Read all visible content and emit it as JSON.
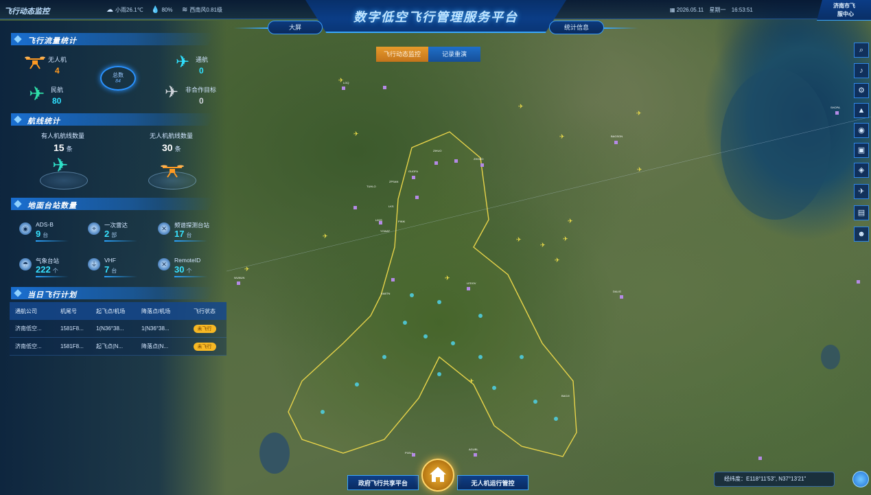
{
  "header": {
    "brand": "飞行动态监控",
    "weather": "小雨26.1℃",
    "humidity": "80%",
    "wind": "西南风0.81级",
    "date": "2026.05.11",
    "weekday": "星期一",
    "time": "16:53:51",
    "title": "数字低空飞行管理服务平台",
    "tab_left": "大屏",
    "tab_right": "统计信息",
    "city_line1": "济南市飞",
    "city_line2": "服中心"
  },
  "mode_toggle": {
    "active": "飞行动态监控",
    "other": "记录重演"
  },
  "flight_flow": {
    "title": "飞行流量统计",
    "drone": {
      "label": "无人机",
      "value": "4"
    },
    "general": {
      "label": "通航",
      "value": "0"
    },
    "civil": {
      "label": "民航",
      "value": "80"
    },
    "noncoop": {
      "label": "非合作目标",
      "value": "0"
    },
    "total": {
      "label": "总数",
      "value": "84"
    }
  },
  "routes": {
    "title": "航线统计",
    "manned": {
      "label": "有人机航线数量",
      "value": "15",
      "unit": "条"
    },
    "unmanned": {
      "label": "无人机航线数量",
      "value": "30",
      "unit": "条"
    }
  },
  "ground_stations": {
    "title": "地面台站数量",
    "items": [
      {
        "name": "ADS-B",
        "value": "9",
        "unit": "台"
      },
      {
        "name": "一次雷达",
        "value": "2",
        "unit": "部"
      },
      {
        "name": "频谱探测台站",
        "value": "17",
        "unit": "台"
      },
      {
        "name": "气象台站",
        "value": "222",
        "unit": "个"
      },
      {
        "name": "VHF",
        "value": "7",
        "unit": "台"
      },
      {
        "name": "RemoteID",
        "value": "30",
        "unit": "个"
      }
    ]
  },
  "flight_plan": {
    "title": "当日飞行计划",
    "columns": [
      "通航公司",
      "机尾号",
      "起飞点/机场",
      "降落点/机场",
      "飞行状态"
    ],
    "rows": [
      [
        "济南低空...",
        "1581F8...",
        "1(N36°38...",
        "1(N36°38...",
        "未飞行"
      ],
      [
        "济南低空...",
        "1581F8...",
        "起飞点(N...",
        "降落点(N...",
        "未飞行"
      ]
    ]
  },
  "bottom": {
    "left_tab": "政府飞行共享平台",
    "right_tab": "无人机运行管控",
    "coords": "经纬度：E118°11'53\", N37°13'21\""
  },
  "toolbar": [
    "search-icon",
    "bell-icon",
    "gear-icon",
    "warning-icon",
    "eye-icon",
    "camera-icon",
    "layers-icon",
    "flight-icon",
    "photo-icon",
    "user-icon"
  ],
  "map_labels": [
    "LGQ",
    "BAGSON",
    "SHOPA",
    "WUNUN",
    "ZIHUO",
    "LKS",
    "TUHLO",
    "ZPSAN",
    "GUOFA",
    "ZHODO",
    "LIKIS",
    "PIKIK",
    "LEDOV",
    "DALIG",
    "YOWAT",
    "P1ELI",
    "AGUBL",
    "XABTN",
    "BAOJI"
  ],
  "colors": {
    "accent": "#38a8ff",
    "orange": "#ff9a22",
    "cyan": "#2fe0ff",
    "boundary": "#e8d44a"
  }
}
